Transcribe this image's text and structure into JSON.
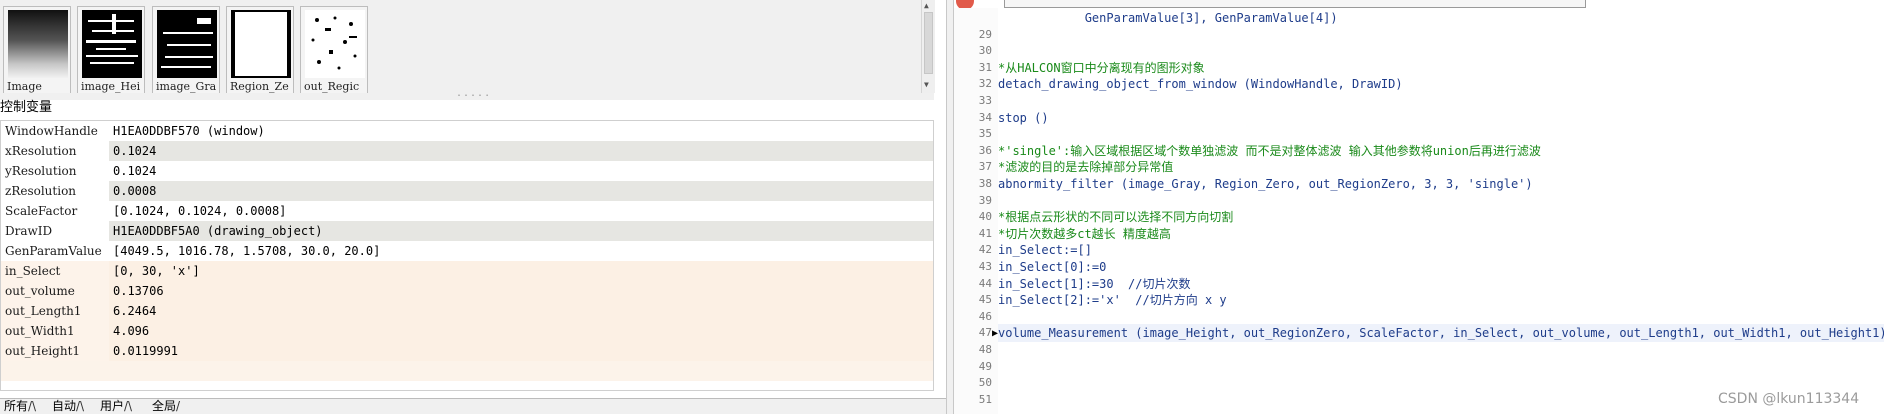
{
  "thumbnails": [
    {
      "caption": "Image"
    },
    {
      "caption": "image_Hei"
    },
    {
      "caption": "image_Gra"
    },
    {
      "caption": "Region_Ze"
    },
    {
      "caption": "out_Regic"
    }
  ],
  "variables_panel": {
    "title": "控制变量",
    "rows": [
      {
        "name": "WindowHandle",
        "value": "H1EA0DDBF570 (window)",
        "style": "white"
      },
      {
        "name": "xResolution",
        "value": "0.1024",
        "style": "grey"
      },
      {
        "name": "yResolution",
        "value": "0.1024",
        "style": "white"
      },
      {
        "name": "zResolution",
        "value": "0.0008",
        "style": "grey"
      },
      {
        "name": "ScaleFactor",
        "value": "[0.1024, 0.1024, 0.0008]",
        "style": "white"
      },
      {
        "name": "DrawID",
        "value": "H1EA0DDBF5A0 (drawing_object)",
        "style": "grey"
      },
      {
        "name": "GenParamValue",
        "value": "[4049.5, 1016.78, 1.5708, 30.0, 20.0]",
        "style": "white"
      },
      {
        "name": "in_Select",
        "value": "[0, 30, 'x']",
        "style": "ctrl"
      },
      {
        "name": "out_volume",
        "value": "0.13706",
        "style": "ctrl"
      },
      {
        "name": "out_Length1",
        "value": "6.2464",
        "style": "ctrl"
      },
      {
        "name": "out_Width1",
        "value": "4.096",
        "style": "ctrl"
      },
      {
        "name": "out_Height1",
        "value": "0.0119991",
        "style": "ctrl"
      }
    ]
  },
  "bottom_tabs": [
    "所有",
    "自动",
    "用户",
    "全局"
  ],
  "editor": {
    "lines": [
      {
        "num": "",
        "text": "            GenParamValue[3], GenParamValue[4])",
        "kind": "normal"
      },
      {
        "num": "29",
        "text": "",
        "kind": "normal"
      },
      {
        "num": "30",
        "text": "",
        "kind": "normal"
      },
      {
        "num": "31",
        "text": "*从HALCON窗口中分离现有的图形对象",
        "kind": "comment"
      },
      {
        "num": "32",
        "text": "detach_drawing_object_from_window (WindowHandle, DrawID)",
        "kind": "normal"
      },
      {
        "num": "33",
        "text": "",
        "kind": "normal"
      },
      {
        "num": "34",
        "text": "stop ()",
        "kind": "normal"
      },
      {
        "num": "35",
        "text": "",
        "kind": "normal"
      },
      {
        "num": "36",
        "text": "*'single':输入区域根据区域个数单独滤波 而不是对整体滤波 输入其他参数将union后再进行滤波",
        "kind": "comment"
      },
      {
        "num": "37",
        "text": "*滤波的目的是去除掉部分异常值",
        "kind": "comment"
      },
      {
        "num": "38",
        "text": "abnormity_filter (image_Gray, Region_Zero, out_RegionZero, 3, 3, 'single')",
        "kind": "normal"
      },
      {
        "num": "39",
        "text": "",
        "kind": "normal"
      },
      {
        "num": "40",
        "text": "*根据点云形状的不同可以选择不同方向切割",
        "kind": "comment"
      },
      {
        "num": "41",
        "text": "*切片次数越多ct越长 精度越高",
        "kind": "comment"
      },
      {
        "num": "42",
        "text": "in_Select:=[]",
        "kind": "normal"
      },
      {
        "num": "43",
        "text": "in_Select[0]:=0",
        "kind": "normal"
      },
      {
        "num": "44",
        "text": "in_Select[1]:=30  //切片次数",
        "kind": "normal"
      },
      {
        "num": "45",
        "text": "in_Select[2]:='x'  //切片方向 x y",
        "kind": "normal"
      },
      {
        "num": "46",
        "text": "",
        "kind": "normal"
      },
      {
        "num": "47",
        "text": "volume_Measurement (image_Height, out_RegionZero, ScaleFactor, in_Select, out_volume, out_Length1, out_Width1, out_Height1)",
        "kind": "normal"
      },
      {
        "num": "48",
        "text": "",
        "kind": "normal"
      },
      {
        "num": "49",
        "text": "",
        "kind": "normal"
      },
      {
        "num": "50",
        "text": "",
        "kind": "normal"
      },
      {
        "num": "51",
        "text": "",
        "kind": "normal"
      }
    ]
  },
  "watermark": "CSDN @lkun113344",
  "colors": {
    "comment": "#1a8a1a",
    "code": "#1e3c8a",
    "control_row": "#fcf0e4",
    "grey_row": "#e6e6e2"
  }
}
